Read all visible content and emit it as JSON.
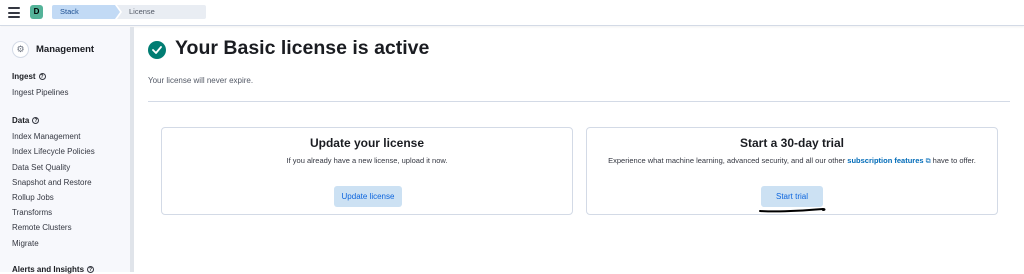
{
  "header": {
    "space_initial": "D",
    "breadcrumbs": [
      "Stack Management",
      "License management"
    ]
  },
  "sidebar": {
    "title": "Management",
    "groups": [
      {
        "label": "Ingest",
        "items": [
          "Ingest Pipelines"
        ]
      },
      {
        "label": "Data",
        "items": [
          "Index Management",
          "Index Lifecycle Policies",
          "Data Set Quality",
          "Snapshot and Restore",
          "Rollup Jobs",
          "Transforms",
          "Remote Clusters",
          "Migrate"
        ]
      },
      {
        "label": "Alerts and Insights",
        "items": []
      }
    ]
  },
  "main": {
    "title": "Your Basic license is active",
    "subtitle": "Your license will never expire.",
    "update_card": {
      "title": "Update your license",
      "description": "If you already have a new license, upload it now.",
      "button": "Update license"
    },
    "trial_card": {
      "title": "Start a 30-day trial",
      "description_before": "Experience what machine learning, advanced security, and all our other ",
      "link": "subscription features",
      "description_after": " have to offer.",
      "button": "Start trial"
    }
  },
  "colors": {
    "success": "#017d73",
    "accent": "#0b64dd",
    "space_avatar": "#54b399"
  }
}
